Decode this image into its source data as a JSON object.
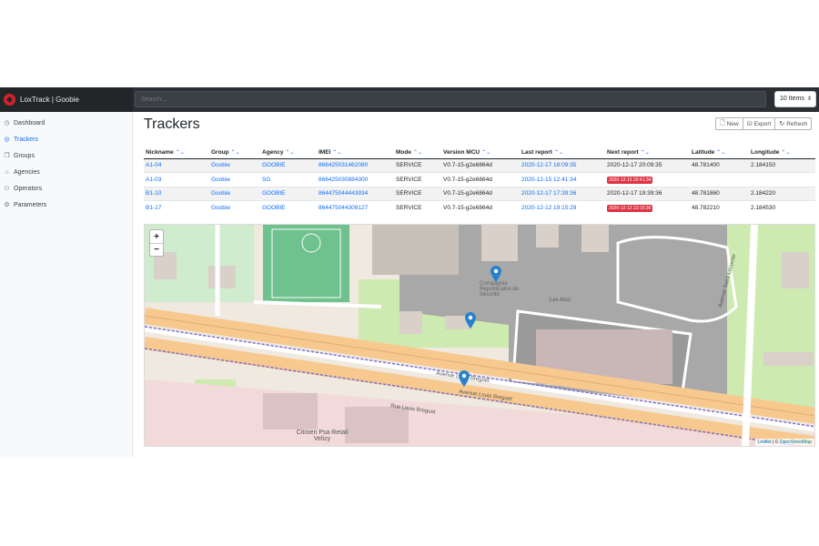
{
  "app": {
    "title": "LoxTrack | Goobie"
  },
  "search": {
    "placeholder": "Search..."
  },
  "items_select": {
    "value": "10 Items"
  },
  "sidebar": {
    "items": [
      {
        "label": "Dashboard",
        "icon": "clock-icon",
        "active": false
      },
      {
        "label": "Trackers",
        "icon": "target-icon",
        "active": true
      },
      {
        "label": "Groups",
        "icon": "layers-icon",
        "active": false
      },
      {
        "label": "Agencies",
        "icon": "building-icon",
        "active": false
      },
      {
        "label": "Operators",
        "icon": "users-icon",
        "active": false
      },
      {
        "label": "Parameters",
        "icon": "gear-icon",
        "active": false
      }
    ]
  },
  "page": {
    "title": "Trackers"
  },
  "toolbar": {
    "new_label": "New",
    "export_label": "Export",
    "refresh_label": "Refresh"
  },
  "table": {
    "columns": [
      "Nickname",
      "Group",
      "Agency",
      "IMEI",
      "Mode",
      "Version MCU",
      "Last report",
      "Next report",
      "Latitude",
      "Longitude"
    ],
    "rows": [
      {
        "nickname": "A1-04",
        "group": "Goobie",
        "agency": "GOOBIE",
        "imei": "866425031462080",
        "mode": "SERVICE",
        "version": "V0.7-15-g2e6864d",
        "last_report": "2020-12-17 18:09:35",
        "next_report": "2020-12-17 20:09:35",
        "next_overdue": false,
        "latitude": "48.781400",
        "longitude": "2.184150"
      },
      {
        "nickname": "A1-03",
        "group": "Goobie",
        "agency": "SG",
        "imei": "866425030884300",
        "mode": "SERVICE",
        "version": "V0.7-15-g2e6864d",
        "last_report": "2020-12-15 12:41:34",
        "next_report": "2020-12-15 20:41:34",
        "next_overdue": true,
        "latitude": "",
        "longitude": ""
      },
      {
        "nickname": "B1-10",
        "group": "Goobie",
        "agency": "GOOBIE",
        "imei": "864475044443934",
        "mode": "SERVICE",
        "version": "V0.7-15-g2e6864d",
        "last_report": "2020-12-17 17:39:36",
        "next_report": "2020-12-17 19:39:36",
        "next_overdue": false,
        "latitude": "48.781860",
        "longitude": "2.184220"
      },
      {
        "nickname": "B1-17",
        "group": "Goobie",
        "agency": "GOOBIE",
        "imei": "864475044309127",
        "mode": "SERVICE",
        "version": "V0.7-15-g2e6864d",
        "last_report": "2020-12-12 19:15:29",
        "next_report": "2020-12-12 23:15:30",
        "next_overdue": true,
        "latitude": "48.782210",
        "longitude": "2.184530"
      }
    ]
  },
  "map": {
    "zoom_in": "+",
    "zoom_out": "−",
    "attribution_leaflet": "Leaflet",
    "attribution_sep": " | © ",
    "attribution_osm": "OpenStreetMap",
    "labels": {
      "street1": "Avenue Louis Breguet",
      "street2": "Avenue Louis Breguet",
      "street3": "Rue Louis Breguet",
      "avenue_saint": "Avenue Saint Lecomte",
      "place": "Citroen Psa Retail Velizy",
      "company": "Compagnie Républicaine de Sécurité",
      "les_arcs": "Les Arcs"
    },
    "marker_color": "#2a81cb"
  },
  "colors": {
    "accent": "#0d6efd",
    "danger": "#dc3545",
    "topbar": "#2b2f33"
  }
}
